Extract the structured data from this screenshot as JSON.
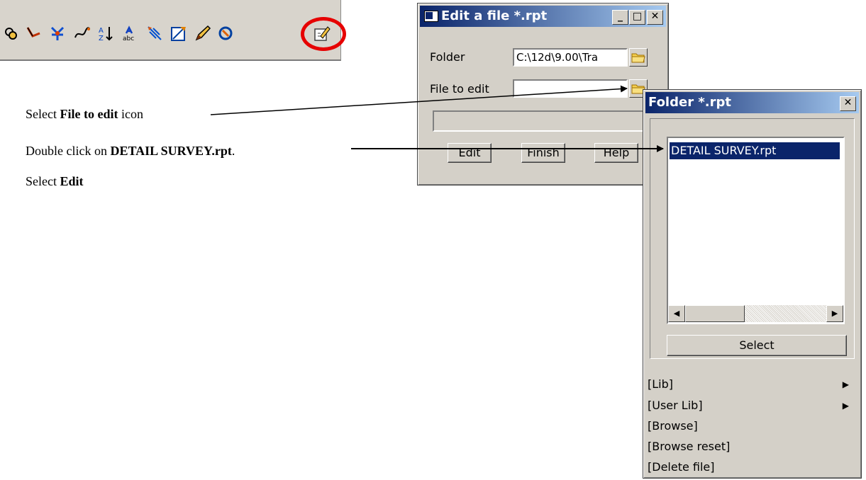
{
  "toolbar": {
    "icons": [
      "toolbar-icon-1",
      "toolbar-icon-2",
      "toolbar-icon-3",
      "toolbar-icon-4",
      "sort-az-icon",
      "spell-check-icon",
      "toolbar-icon-7",
      "toolbar-icon-8",
      "pencil-icon",
      "toolbar-icon-10",
      "edit-file-icon"
    ],
    "highlight_color": "#e60000"
  },
  "instructions": {
    "step1_prefix": "Select ",
    "step1_bold": "File to edit",
    "step1_suffix": " icon",
    "step2_prefix": "Double click on ",
    "step2_bold": "DETAIL SURVEY.rpt",
    "step2_suffix": ".",
    "step3_prefix": "Select ",
    "step3_bold": "Edit"
  },
  "edit_dialog": {
    "title": "Edit a file *.rpt",
    "folder_label": "Folder",
    "folder_value": "C:\\12d\\9.00\\Tra",
    "file_label": "File to edit",
    "file_value": "",
    "buttons": {
      "edit": "Edit",
      "finish": "Finish",
      "help": "Help"
    },
    "title_color_start": "#0a246a",
    "title_color_end": "#a6caf0"
  },
  "folder_popup": {
    "title": "Folder *.rpt",
    "selected_file": "DETAIL SURVEY.rpt",
    "select_button": "Select",
    "menu": [
      {
        "label": "[Lib]",
        "submenu": true
      },
      {
        "label": "[User Lib]",
        "submenu": true
      },
      {
        "label": "[Browse]",
        "submenu": false
      },
      {
        "label": "[Browse reset]",
        "submenu": false
      },
      {
        "label": "[Delete file]",
        "submenu": false
      }
    ]
  },
  "colors": {
    "window_face": "#d4d0c8",
    "selection": "#0a246a"
  }
}
